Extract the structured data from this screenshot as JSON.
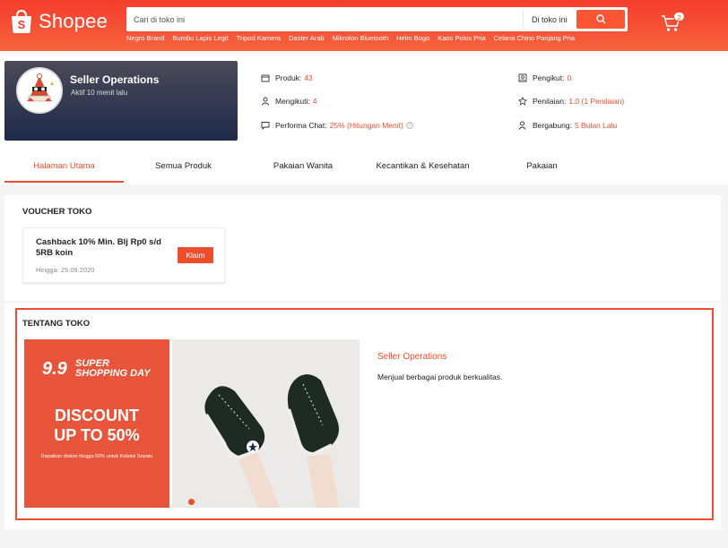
{
  "brand": {
    "name": "Shopee",
    "primary": "#ee4d2d"
  },
  "header": {
    "search_placeholder": "Cari di toko ini",
    "search_scope": "Di toko ini",
    "cart_count": "2",
    "keywords": [
      "Negro Brand",
      "Bumbu Lapis Legit",
      "Tripod Kamera",
      "Daster Arab",
      "Mikrofon Bluetooth",
      "Helm Bogo",
      "Kaos Polos Pria",
      "Celana Chino Panjang Pria"
    ]
  },
  "shop": {
    "name": "Seller Operations",
    "active": "Aktif 10 menit lalu",
    "stats": {
      "produk": {
        "label": "Produk:",
        "value": "43"
      },
      "mengikuti": {
        "label": "Mengikuti:",
        "value": "4"
      },
      "performa": {
        "label": "Performa Chat:",
        "value": "25% (Hitungan Menit)"
      },
      "pengikut": {
        "label": "Pengikut:",
        "value": "0"
      },
      "penilaian": {
        "label": "Penilaian:",
        "value": "1.0 (1 Penilaian)"
      },
      "bergabung": {
        "label": "Bergabung:",
        "value": "5 Bulan Lalu"
      }
    }
  },
  "tabs": [
    "Halaman Utama",
    "Semua Produk",
    "Pakaian Wanita",
    "Kecantikan & Kesehatan",
    "Pakaian"
  ],
  "voucher_section": {
    "title": "VOUCHER TOKO",
    "voucher_title": "Cashback 10% Min. Blj Rp0 s/d 5RB koin",
    "expiry": "Hingga: 25.09.2020",
    "claim_label": "Klaim"
  },
  "about_section": {
    "title": "TENTANG TOKO",
    "shop_name": "Seller Operations",
    "description": "Menjual berbagai produk berkualitas.",
    "banner": {
      "num": "9.9",
      "line1": "SUPER",
      "line2": "SHOPPING DAY",
      "discount1": "DISCOUNT",
      "discount2": "UP TO 50%",
      "small": "Dapatkan diskon hingga 50% untuk Koleksi Sepatu"
    }
  }
}
